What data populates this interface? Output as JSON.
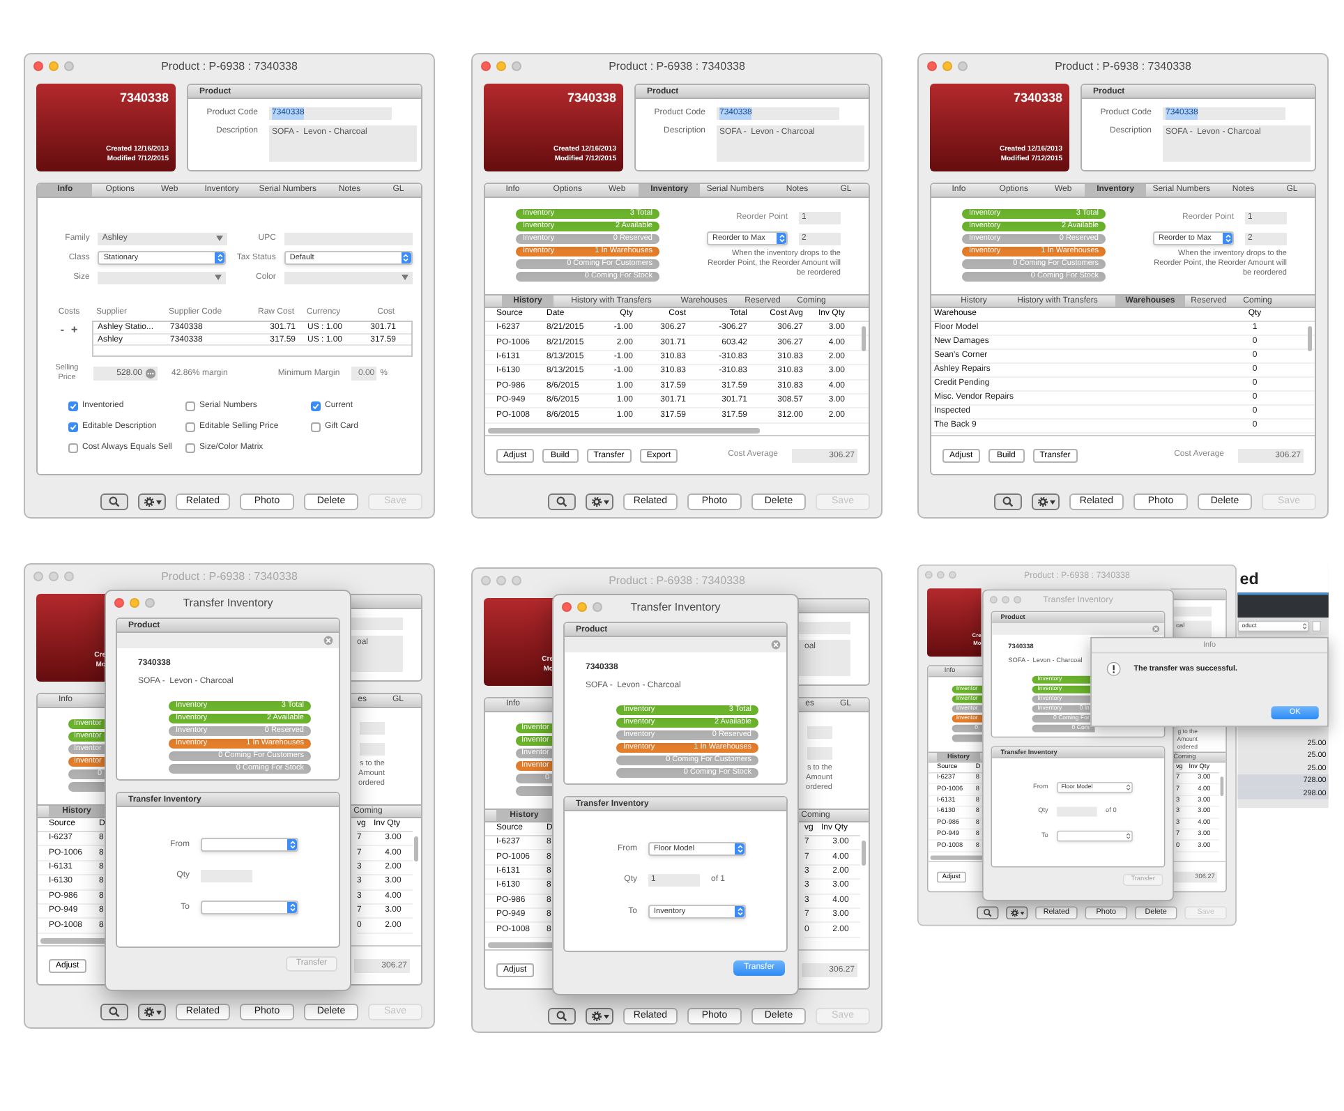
{
  "panels": [
    {
      "kind": "full",
      "window": {
        "title": "Product : P-6938 : 7340338",
        "active": true
      },
      "header": {
        "number": "7340338",
        "created": "Created 12/16/2013",
        "modified": "Modified 7/12/2015"
      },
      "product": {
        "heading": "Product",
        "code_label": "Product Code",
        "code": "7340338",
        "description_label": "Description",
        "description": "SOFA -  Levon - Charcoal"
      },
      "tabs": [
        {
          "label": "Info",
          "selected": true
        },
        {
          "label": "Options",
          "selected": false
        },
        {
          "label": "Web",
          "selected": false
        },
        {
          "label": "Inventory",
          "selected": false
        },
        {
          "label": "Serial Numbers",
          "selected": false
        },
        {
          "label": "Notes",
          "selected": false
        },
        {
          "label": "GL",
          "selected": false
        }
      ],
      "content": {
        "kind": "info",
        "fields": [
          [
            {
              "label": "Family",
              "kind": "combo",
              "value": "Ashley"
            },
            {
              "label": "UPC",
              "kind": "text"
            }
          ],
          [
            {
              "label": "Class",
              "kind": "popup",
              "value": "Stationary"
            },
            {
              "label": "Tax Status",
              "kind": "popup",
              "value": "Default"
            }
          ],
          [
            {
              "label": "Size",
              "kind": "combo"
            },
            {
              "label": "Color",
              "kind": "combo"
            }
          ]
        ],
        "costs": {
          "label": "Costs",
          "remove": "-",
          "add": "+",
          "columns": [
            "Supplier",
            "Supplier Code",
            "Raw Cost",
            "Currency",
            "Cost"
          ],
          "rows": [
            [
              "Ashley Statio...",
              "7340338",
              "301.71",
              "US : 1.00",
              "301.71"
            ],
            [
              "Ashley",
              "7340338",
              "317.59",
              "US : 1.00",
              "317.59"
            ]
          ]
        },
        "selling": {
          "label": "Selling Price",
          "value": "528.00",
          "margin": "42.86% margin",
          "minimum_label": "Minimum Margin",
          "minimum": "0.00",
          "unit": "%"
        },
        "checkboxes": [
          {
            "label": "Inventoried",
            "checked": true
          },
          {
            "label": "Serial Numbers",
            "checked": false
          },
          {
            "label": "Current",
            "checked": true
          },
          {
            "label": "Editable Description",
            "checked": true
          },
          {
            "label": "Editable Selling Price",
            "checked": false
          },
          {
            "label": "Gift Card",
            "checked": false
          },
          {
            "label": "Cost Always Equals Sell",
            "checked": false
          },
          {
            "label": "Size/Color Matrix",
            "checked": false
          }
        ]
      },
      "buttons": [
        {
          "kind": "search"
        },
        {
          "kind": "gear"
        },
        {
          "kind": "text",
          "label": "Related",
          "disabled": false
        },
        {
          "kind": "text",
          "label": "Photo",
          "disabled": false
        },
        {
          "kind": "text",
          "label": "Delete",
          "disabled": false
        },
        {
          "kind": "text",
          "label": "Save",
          "disabled": true
        }
      ]
    },
    {
      "kind": "full",
      "window": {
        "title": "Product : P-6938 : 7340338",
        "active": true
      },
      "header": {
        "number": "7340338",
        "created": "Created 12/16/2013",
        "modified": "Modified 7/12/2015"
      },
      "product": {
        "heading": "Product",
        "code_label": "Product Code",
        "code": "7340338",
        "description_label": "Description",
        "description": "SOFA -  Levon - Charcoal"
      },
      "tabs": [
        {
          "label": "Info",
          "selected": false
        },
        {
          "label": "Options",
          "selected": false
        },
        {
          "label": "Web",
          "selected": false
        },
        {
          "label": "Inventory",
          "selected": true
        },
        {
          "label": "Serial Numbers",
          "selected": false
        },
        {
          "label": "Notes",
          "selected": false
        },
        {
          "label": "GL",
          "selected": false
        }
      ],
      "content": {
        "kind": "inventory",
        "bars": [
          {
            "label": "Inventory",
            "value": "3 Total",
            "color": "#6cb52d"
          },
          {
            "label": "Inventory",
            "value": "2 Available",
            "color": "#6cb52d"
          },
          {
            "label": "Inventory",
            "value": "0 Reserved",
            "color": "#b3b3b3"
          },
          {
            "label": "Inventory",
            "value": "1 In Warehouses",
            "color": "#e57f2c"
          },
          {
            "value": "0 Coming For Customers",
            "color": "#b3b3b3"
          },
          {
            "value": "0 Coming For Stock",
            "color": "#b3b3b3"
          }
        ],
        "reorder": {
          "point_label": "Reorder Point",
          "point": "1",
          "mode": "Reorder to Max",
          "amount": "2",
          "note": "When the inventory drops to the Reorder Point, the Reorder Amount will be reordered"
        },
        "subtabs": [
          {
            "label": "History",
            "selected": true
          },
          {
            "label": "History with Transfers",
            "selected": false
          },
          {
            "label": "Warehouses",
            "selected": false
          },
          {
            "label": "Reserved",
            "selected": false
          },
          {
            "label": "Coming",
            "selected": false
          }
        ],
        "table": {
          "kind": "history",
          "columns": [
            "Source",
            "Date",
            "Qty",
            "Cost",
            "Total",
            "Cost Avg",
            "Inv Qty"
          ],
          "rows": [
            [
              "I-6237",
              "8/21/2015",
              "-1.00",
              "306.27",
              "-306.27",
              "306.27",
              "3.00"
            ],
            [
              "PO-1006",
              "8/21/2015",
              "2.00",
              "301.71",
              "603.42",
              "306.27",
              "4.00"
            ],
            [
              "I-6131",
              "8/13/2015",
              "-1.00",
              "310.83",
              "-310.83",
              "310.83",
              "2.00"
            ],
            [
              "I-6130",
              "8/13/2015",
              "-1.00",
              "310.83",
              "-310.83",
              "310.83",
              "3.00"
            ],
            [
              "PO-986",
              "8/6/2015",
              "1.00",
              "317.59",
              "317.59",
              "310.83",
              "4.00"
            ],
            [
              "PO-949",
              "8/6/2015",
              "1.00",
              "301.71",
              "301.71",
              "308.57",
              "3.00"
            ],
            [
              "PO-1008",
              "8/6/2015",
              "1.00",
              "317.59",
              "317.59",
              "312.00",
              "2.00"
            ]
          ]
        },
        "actions": [
          "Adjust",
          "Build",
          "Transfer",
          "Export"
        ],
        "cost_average_label": "Cost Average",
        "cost_average": "306.27"
      },
      "buttons": [
        {
          "kind": "search"
        },
        {
          "kind": "gear"
        },
        {
          "kind": "text",
          "label": "Related",
          "disabled": false
        },
        {
          "kind": "text",
          "label": "Photo",
          "disabled": false
        },
        {
          "kind": "text",
          "label": "Delete",
          "disabled": false
        },
        {
          "kind": "text",
          "label": "Save",
          "disabled": true
        }
      ]
    },
    {
      "kind": "full",
      "window": {
        "title": "Product : P-6938 : 7340338",
        "active": true
      },
      "header": {
        "number": "7340338",
        "created": "Created 12/16/2013",
        "modified": "Modified 7/12/2015"
      },
      "product": {
        "heading": "Product",
        "code_label": "Product Code",
        "code": "7340338",
        "description_label": "Description",
        "description": "SOFA -  Levon - Charcoal"
      },
      "tabs": [
        {
          "label": "Info",
          "selected": false
        },
        {
          "label": "Options",
          "selected": false
        },
        {
          "label": "Web",
          "selected": false
        },
        {
          "label": "Inventory",
          "selected": true
        },
        {
          "label": "Serial Numbers",
          "selected": false
        },
        {
          "label": "Notes",
          "selected": false
        },
        {
          "label": "GL",
          "selected": false
        }
      ],
      "content": {
        "kind": "inventory",
        "bars": [
          {
            "label": "Inventory",
            "value": "3 Total",
            "color": "#6cb52d"
          },
          {
            "label": "Inventory",
            "value": "2 Available",
            "color": "#6cb52d"
          },
          {
            "label": "Inventory",
            "value": "0 Reserved",
            "color": "#b3b3b3"
          },
          {
            "label": "Inventory",
            "value": "1 In Warehouses",
            "color": "#e57f2c"
          },
          {
            "value": "0 Coming For Customers",
            "color": "#b3b3b3"
          },
          {
            "value": "0 Coming For Stock",
            "color": "#b3b3b3"
          }
        ],
        "reorder": {
          "point_label": "Reorder Point",
          "point": "1",
          "mode": "Reorder to Max",
          "amount": "2",
          "note": "When the inventory drops to the Reorder Point, the Reorder Amount will be reordered"
        },
        "subtabs": [
          {
            "label": "History",
            "selected": false
          },
          {
            "label": "History with Transfers",
            "selected": false
          },
          {
            "label": "Warehouses",
            "selected": true
          },
          {
            "label": "Reserved",
            "selected": false
          },
          {
            "label": "Coming",
            "selected": false
          }
        ],
        "table": {
          "kind": "warehouses",
          "columns": [
            "Warehouse",
            "Qty"
          ],
          "rows": [
            [
              "Floor Model",
              "1"
            ],
            [
              "New Damages",
              "0"
            ],
            [
              "Sean's Corner",
              "0"
            ],
            [
              "Ashley Repairs",
              "0"
            ],
            [
              "Credit Pending",
              "0"
            ],
            [
              "Misc. Vendor Repairs",
              "0"
            ],
            [
              "Inspected",
              "0"
            ],
            [
              "The Back 9",
              "0"
            ]
          ]
        },
        "actions": [
          "Adjust",
          "Build",
          "Transfer"
        ],
        "cost_average_label": "Cost Average",
        "cost_average": "306.27"
      },
      "buttons": [
        {
          "kind": "search"
        },
        {
          "kind": "gear"
        },
        {
          "kind": "text",
          "label": "Related",
          "disabled": false
        },
        {
          "kind": "text",
          "label": "Photo",
          "disabled": false
        },
        {
          "kind": "text",
          "label": "Delete",
          "disabled": false
        },
        {
          "kind": "text",
          "label": "Save",
          "disabled": true
        }
      ]
    },
    {
      "kind": "covered",
      "window": {
        "title": "Product : P-6938 : 7340338",
        "active": false
      },
      "left": {
        "header": [
          "Cre",
          "Mo"
        ],
        "tab": {
          "label": "Info",
          "selected": false
        },
        "bars": [
          {
            "kind": "label",
            "text": "Inventor",
            "color": "#6cb52d"
          },
          {
            "kind": "label",
            "text": "Inventor",
            "color": "#6cb52d"
          },
          {
            "kind": "label",
            "text": "Inventor",
            "color": "#b3b3b3"
          },
          {
            "kind": "label",
            "text": "Inventor",
            "color": "#e57f2c"
          },
          {
            "kind": "value",
            "text": "0",
            "color": "#b3b3b3"
          },
          {
            "kind": "blank",
            "color": "#b3b3b3"
          }
        ],
        "subtab": {
          "label": "History",
          "selected": true
        },
        "columns": [
          "Source",
          "D"
        ],
        "rows": [
          [
            "I-6237",
            "8"
          ],
          [
            "PO-1006",
            "8"
          ],
          [
            "I-6131",
            "8"
          ],
          [
            "I-6130",
            "8"
          ],
          [
            "PO-986",
            "8"
          ],
          [
            "PO-949",
            "8"
          ],
          [
            "PO-1008",
            "8"
          ]
        ],
        "action": "Adjust"
      },
      "right": {
        "description": "oal",
        "tabs": [
          "es",
          "GL"
        ],
        "reorder_fields": true,
        "note": [
          "s to the",
          "Amount",
          "ordered"
        ],
        "subtab": "Coming",
        "columns": [
          "vg",
          "Inv Qty"
        ],
        "rows": [
          [
            "7",
            "3.00"
          ],
          [
            "7",
            "4.00"
          ],
          [
            "3",
            "2.00"
          ],
          [
            "3",
            "3.00"
          ],
          [
            "3",
            "4.00"
          ],
          [
            "7",
            "3.00"
          ],
          [
            "0",
            "2.00"
          ]
        ],
        "cost_average": "306.27"
      },
      "buttons": [
        {
          "kind": "search"
        },
        {
          "kind": "gear"
        },
        {
          "kind": "text",
          "label": "Related",
          "disabled": false
        },
        {
          "kind": "text",
          "label": "Photo",
          "disabled": false
        },
        {
          "kind": "text",
          "label": "Delete",
          "disabled": false
        },
        {
          "kind": "text",
          "label": "Save",
          "disabled": true
        }
      ],
      "dialog": {
        "window": {
          "title": "Transfer Inventory",
          "active": true
        },
        "product": {
          "heading": "Product",
          "code": "7340338",
          "description": "SOFA -  Levon - Charcoal",
          "bars": [
            {
              "label": "Inventory",
              "value": "3 Total",
              "color": "#6cb52d"
            },
            {
              "label": "Inventory",
              "value": "2 Available",
              "color": "#6cb52d"
            },
            {
              "label": "Inventory",
              "value": "0 Reserved",
              "color": "#b3b3b3"
            },
            {
              "label": "Inventory",
              "value": "1 In Warehouses",
              "color": "#e57f2c"
            },
            {
              "value": "0 Coming For Customers",
              "color": "#b3b3b3"
            },
            {
              "value": "0 Coming For Stock",
              "color": "#b3b3b3"
            }
          ]
        },
        "transfer": {
          "heading": "Transfer Inventory",
          "from_label": "From",
          "qty_label": "Qty",
          "to_label": "To",
          "button": {
            "label": "Transfer",
            "disabled": true
          }
        }
      }
    },
    {
      "kind": "covered",
      "window": {
        "title": "Product : P-6938 : 7340338",
        "active": false
      },
      "left": {
        "header": [
          "Cre",
          "Mo"
        ],
        "tab": {
          "label": "Info",
          "selected": false
        },
        "bars": [
          {
            "kind": "label",
            "text": "Inventor",
            "color": "#6cb52d"
          },
          {
            "kind": "label",
            "text": "Inventor",
            "color": "#6cb52d"
          },
          {
            "kind": "label",
            "text": "Inventor",
            "color": "#b3b3b3"
          },
          {
            "kind": "label",
            "text": "Inventor",
            "color": "#e57f2c"
          },
          {
            "kind": "value",
            "text": "0",
            "color": "#b3b3b3"
          },
          {
            "kind": "blank",
            "color": "#b3b3b3"
          }
        ],
        "subtab": {
          "label": "History",
          "selected": true
        },
        "columns": [
          "Source",
          "D"
        ],
        "rows": [
          [
            "I-6237",
            "8"
          ],
          [
            "PO-1006",
            "8"
          ],
          [
            "I-6131",
            "8"
          ],
          [
            "I-6130",
            "8"
          ],
          [
            "PO-986",
            "8"
          ],
          [
            "PO-949",
            "8"
          ],
          [
            "PO-1008",
            "8"
          ]
        ],
        "action": "Adjust"
      },
      "right": {
        "description": "oal",
        "tabs": [
          "es",
          "GL"
        ],
        "reorder_fields": true,
        "note": [
          "s to the",
          "Amount",
          "ordered"
        ],
        "subtab": "Coming",
        "columns": [
          "vg",
          "Inv Qty"
        ],
        "rows": [
          [
            "7",
            "3.00"
          ],
          [
            "7",
            "4.00"
          ],
          [
            "3",
            "2.00"
          ],
          [
            "3",
            "3.00"
          ],
          [
            "3",
            "4.00"
          ],
          [
            "7",
            "3.00"
          ],
          [
            "0",
            "2.00"
          ]
        ],
        "cost_average": "306.27"
      },
      "buttons": [
        {
          "kind": "search"
        },
        {
          "kind": "gear"
        },
        {
          "kind": "text",
          "label": "Related",
          "disabled": false
        },
        {
          "kind": "text",
          "label": "Photo",
          "disabled": false
        },
        {
          "kind": "text",
          "label": "Delete",
          "disabled": false
        },
        {
          "kind": "text",
          "label": "Save",
          "disabled": true
        }
      ],
      "dialog": {
        "window": {
          "title": "Transfer Inventory",
          "active": true
        },
        "product": {
          "heading": "Product",
          "code": "7340338",
          "description": "SOFA -  Levon - Charcoal",
          "bars": [
            {
              "label": "Inventory",
              "value": "3 Total",
              "color": "#6cb52d"
            },
            {
              "label": "Inventory",
              "value": "2 Available",
              "color": "#6cb52d"
            },
            {
              "label": "Inventory",
              "value": "0 Reserved",
              "color": "#b3b3b3"
            },
            {
              "label": "Inventory",
              "value": "1 In Warehouses",
              "color": "#e57f2c"
            },
            {
              "value": "0 Coming For Customers",
              "color": "#b3b3b3"
            },
            {
              "value": "0 Coming For Stock",
              "color": "#b3b3b3"
            }
          ]
        },
        "transfer": {
          "heading": "Transfer Inventory",
          "from_label": "From",
          "from": "Floor Model",
          "qty_label": "Qty",
          "qty": "1",
          "of": "of 1",
          "to_label": "To",
          "to": "Inventory",
          "button": {
            "label": "Transfer",
            "disabled": false
          }
        }
      }
    },
    {
      "kind": "covered",
      "window": {
        "title": "Product : P-6938 : 7340338",
        "active": false
      },
      "left": {
        "header": [
          "Cre",
          "Mo"
        ],
        "tab": {
          "label": "Info",
          "selected": false
        },
        "bars": [
          {
            "kind": "label",
            "text": "Inventor",
            "color": "#6cb52d"
          },
          {
            "kind": "label",
            "text": "Inventor",
            "color": "#6cb52d"
          },
          {
            "kind": "label",
            "text": "Inventor",
            "color": "#b3b3b3"
          },
          {
            "kind": "label",
            "text": "Inventor",
            "color": "#e57f2c"
          },
          {
            "kind": "value",
            "text": "0",
            "color": "#b3b3b3"
          },
          {
            "kind": "blank",
            "color": "#b3b3b3"
          }
        ],
        "subtab": {
          "label": "History",
          "selected": true
        },
        "columns": [
          "Source",
          "D"
        ],
        "rows": [
          [
            "I-6237",
            "8"
          ],
          [
            "PO-1006",
            "8"
          ],
          [
            "I-6131",
            "8"
          ],
          [
            "I-6130",
            "8"
          ],
          [
            "PO-986",
            "8"
          ],
          [
            "PO-949",
            "8"
          ],
          [
            "PO-1008",
            "8"
          ]
        ],
        "action": "Adjust"
      },
      "right": {
        "description": "oal",
        "reorder_fields": false,
        "note": [
          "g to the",
          "Amount",
          "ordered"
        ],
        "subtab": "Coming",
        "columns": [
          "vg",
          "Inv Qty"
        ],
        "rows": [
          [
            "7",
            "3.00"
          ],
          [
            "7",
            "4.00"
          ],
          [
            "3",
            "3.00"
          ],
          [
            "3",
            "3.00"
          ],
          [
            "3",
            "4.00"
          ],
          [
            "7",
            "3.00"
          ],
          [
            "0",
            "3.00"
          ]
        ],
        "cost_average": "306.27"
      },
      "buttons": [
        {
          "kind": "search"
        },
        {
          "kind": "gear"
        },
        {
          "kind": "text",
          "label": "Related",
          "disabled": false
        },
        {
          "kind": "text",
          "label": "Photo",
          "disabled": false
        },
        {
          "kind": "text",
          "label": "Delete",
          "disabled": false
        },
        {
          "kind": "text",
          "label": "Save",
          "disabled": true
        }
      ],
      "dialog": {
        "window": {
          "title": "Transfer Inventory",
          "active": false
        },
        "product": {
          "heading": "Product",
          "code": "7340338",
          "description": "SOFA -  Levon - Charcoal",
          "bars": [
            {
              "label": "Inventory",
              "color": "#6cb52d"
            },
            {
              "label": "Inventory",
              "color": "#6cb52d"
            },
            {
              "label": "Inventory",
              "color": "#b3b3b3"
            },
            {
              "label": "Inventory",
              "value": "0 In",
              "color": "#b3b3b3"
            },
            {
              "value": "0 Coming For",
              "color": "#b3b3b3"
            },
            {
              "value": "0 Com",
              "color": "#b3b3b3"
            }
          ]
        },
        "transfer": {
          "heading": "Transfer Inventory",
          "from_label": "From",
          "from": "Floor Model",
          "qty_label": "Qty",
          "of": "of 0",
          "to_label": "To",
          "button": {
            "label": "Transfer",
            "disabled": true
          }
        }
      },
      "alert": {
        "title": "Info",
        "message": "The transfer was successful.",
        "button": "OK"
      },
      "side_window": {
        "title": "ed",
        "selector": "oduct",
        "values": [
          {
            "value": "25.00",
            "selected": false
          },
          {
            "value": "25.00",
            "selected": false
          },
          {
            "value": "25.00",
            "selected": false
          },
          {
            "value": "728.00",
            "selected": true
          },
          {
            "value": "298.00",
            "selected": true
          }
        ]
      }
    }
  ]
}
